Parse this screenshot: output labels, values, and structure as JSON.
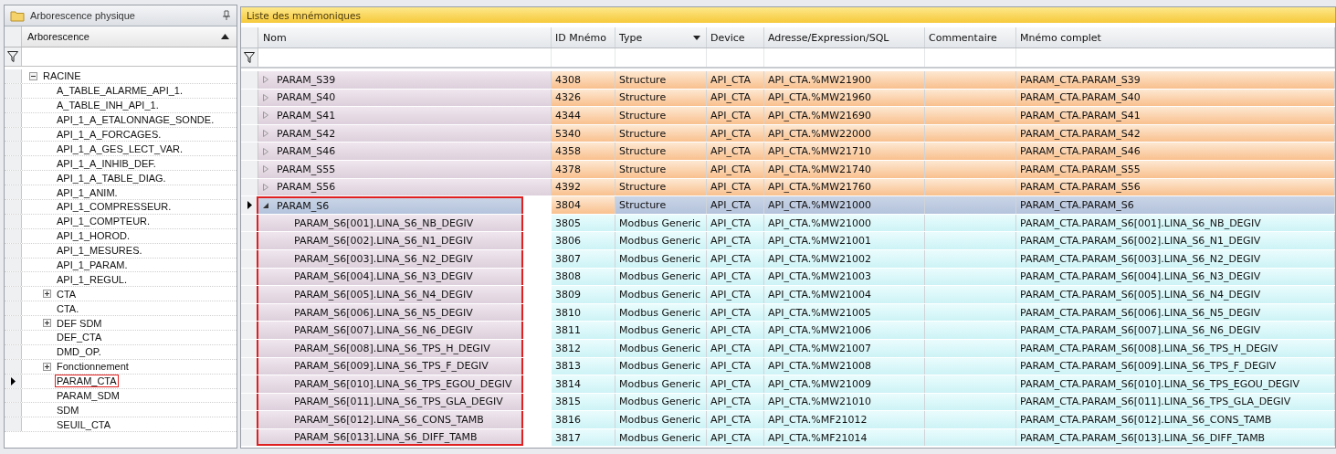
{
  "tree_panel": {
    "title": "Arborescence physique",
    "column": "Arborescence",
    "items": [
      {
        "label": "RACINE",
        "kind": "group",
        "expanded": true,
        "selected": false,
        "highlighted": false,
        "children": [
          {
            "label": "A_TABLE_ALARME_API_1.",
            "kind": "leaf",
            "selected": false,
            "highlighted": false
          },
          {
            "label": "A_TABLE_INH_API_1.",
            "kind": "leaf",
            "selected": false,
            "highlighted": false
          },
          {
            "label": "API_1_A_ETALONNAGE_SONDE.",
            "kind": "leaf",
            "selected": false,
            "highlighted": false
          },
          {
            "label": "API_1_A_FORCAGES.",
            "kind": "leaf",
            "selected": false,
            "highlighted": false
          },
          {
            "label": "API_1_A_GES_LECT_VAR.",
            "kind": "leaf",
            "selected": false,
            "highlighted": false
          },
          {
            "label": "API_1_A_INHIB_DEF.",
            "kind": "leaf",
            "selected": false,
            "highlighted": false
          },
          {
            "label": "API_1_A_TABLE_DIAG.",
            "kind": "leaf",
            "selected": false,
            "highlighted": false
          },
          {
            "label": "API_1_ANIM.",
            "kind": "leaf",
            "selected": false,
            "highlighted": false
          },
          {
            "label": "API_1_COMPRESSEUR.",
            "kind": "leaf",
            "selected": false,
            "highlighted": false
          },
          {
            "label": "API_1_COMPTEUR.",
            "kind": "leaf",
            "selected": false,
            "highlighted": false
          },
          {
            "label": "API_1_HOROD.",
            "kind": "leaf",
            "selected": false,
            "highlighted": false
          },
          {
            "label": "API_1_MESURES.",
            "kind": "leaf",
            "selected": false,
            "highlighted": false
          },
          {
            "label": "API_1_PARAM.",
            "kind": "leaf",
            "selected": false,
            "highlighted": false
          },
          {
            "label": "API_1_REGUL.",
            "kind": "leaf",
            "selected": false,
            "highlighted": false
          },
          {
            "label": "CTA",
            "kind": "group",
            "expanded": false,
            "selected": false,
            "highlighted": false
          },
          {
            "label": "CTA.",
            "kind": "leaf",
            "selected": false,
            "highlighted": false
          },
          {
            "label": "DEF SDM",
            "kind": "group",
            "expanded": false,
            "selected": false,
            "highlighted": false
          },
          {
            "label": "DEF_CTA",
            "kind": "leaf",
            "selected": false,
            "highlighted": false
          },
          {
            "label": "DMD_OP.",
            "kind": "leaf",
            "selected": false,
            "highlighted": false
          },
          {
            "label": "Fonctionnement",
            "kind": "group",
            "expanded": false,
            "selected": false,
            "highlighted": false
          },
          {
            "label": "PARAM_CTA",
            "kind": "leaf",
            "selected": true,
            "highlighted": true
          },
          {
            "label": "PARAM_SDM",
            "kind": "leaf",
            "selected": false,
            "highlighted": false
          },
          {
            "label": "SDM",
            "kind": "leaf",
            "selected": false,
            "highlighted": false
          },
          {
            "label": "SEUIL_CTA",
            "kind": "leaf",
            "selected": false,
            "highlighted": false
          }
        ]
      }
    ]
  },
  "table": {
    "title": "Liste des mnémoniques",
    "columns": [
      "Nom",
      "ID Mnémo",
      "Type",
      "Device",
      "Adresse/Expression/SQL",
      "Commentaire",
      "Mnémo complet"
    ],
    "rows": [
      {
        "kind": "structure",
        "expanded": false,
        "selected": false,
        "highlighted": false,
        "nom": "PARAM_S39",
        "id": "4308",
        "type": "Structure",
        "device": "API_CTA",
        "address": "API_CTA.%MW21900",
        "full": "PARAM_CTA.PARAM_S39"
      },
      {
        "kind": "structure",
        "expanded": false,
        "selected": false,
        "highlighted": false,
        "nom": "PARAM_S40",
        "id": "4326",
        "type": "Structure",
        "device": "API_CTA",
        "address": "API_CTA.%MW21960",
        "full": "PARAM_CTA.PARAM_S40"
      },
      {
        "kind": "structure",
        "expanded": false,
        "selected": false,
        "highlighted": false,
        "nom": "PARAM_S41",
        "id": "4344",
        "type": "Structure",
        "device": "API_CTA",
        "address": "API_CTA.%MW21690",
        "full": "PARAM_CTA.PARAM_S41"
      },
      {
        "kind": "structure",
        "expanded": false,
        "selected": false,
        "highlighted": false,
        "nom": "PARAM_S42",
        "id": "5340",
        "type": "Structure",
        "device": "API_CTA",
        "address": "API_CTA.%MW22000",
        "full": "PARAM_CTA.PARAM_S42"
      },
      {
        "kind": "structure",
        "expanded": false,
        "selected": false,
        "highlighted": false,
        "nom": "PARAM_S46",
        "id": "4358",
        "type": "Structure",
        "device": "API_CTA",
        "address": "API_CTA.%MW21710",
        "full": "PARAM_CTA.PARAM_S46"
      },
      {
        "kind": "structure",
        "expanded": false,
        "selected": false,
        "highlighted": false,
        "nom": "PARAM_S55",
        "id": "4378",
        "type": "Structure",
        "device": "API_CTA",
        "address": "API_CTA.%MW21740",
        "full": "PARAM_CTA.PARAM_S55"
      },
      {
        "kind": "structure",
        "expanded": false,
        "selected": false,
        "highlighted": false,
        "nom": "PARAM_S56",
        "id": "4392",
        "type": "Structure",
        "device": "API_CTA",
        "address": "API_CTA.%MW21760",
        "full": "PARAM_CTA.PARAM_S56"
      },
      {
        "kind": "structure",
        "expanded": true,
        "selected": true,
        "highlighted": true,
        "nom": "PARAM_S6",
        "id": "3804",
        "type": "Structure",
        "device": "API_CTA",
        "address": "API_CTA.%MW21000",
        "full": "PARAM_CTA.PARAM_S6"
      },
      {
        "kind": "member",
        "selected": false,
        "highlighted": true,
        "nom": "PARAM_S6[001].LINA_S6_NB_DEGIV",
        "id": "3805",
        "type": "Modbus Generic",
        "device": "API_CTA",
        "address": "API_CTA.%MW21000",
        "full": "PARAM_CTA.PARAM_S6[001].LINA_S6_NB_DEGIV"
      },
      {
        "kind": "member",
        "selected": false,
        "highlighted": true,
        "nom": "PARAM_S6[002].LINA_S6_N1_DEGIV",
        "id": "3806",
        "type": "Modbus Generic",
        "device": "API_CTA",
        "address": "API_CTA.%MW21001",
        "full": "PARAM_CTA.PARAM_S6[002].LINA_S6_N1_DEGIV"
      },
      {
        "kind": "member",
        "selected": false,
        "highlighted": true,
        "nom": "PARAM_S6[003].LINA_S6_N2_DEGIV",
        "id": "3807",
        "type": "Modbus Generic",
        "device": "API_CTA",
        "address": "API_CTA.%MW21002",
        "full": "PARAM_CTA.PARAM_S6[003].LINA_S6_N2_DEGIV"
      },
      {
        "kind": "member",
        "selected": false,
        "highlighted": true,
        "nom": "PARAM_S6[004].LINA_S6_N3_DEGIV",
        "id": "3808",
        "type": "Modbus Generic",
        "device": "API_CTA",
        "address": "API_CTA.%MW21003",
        "full": "PARAM_CTA.PARAM_S6[004].LINA_S6_N3_DEGIV"
      },
      {
        "kind": "member",
        "selected": false,
        "highlighted": true,
        "nom": "PARAM_S6[005].LINA_S6_N4_DEGIV",
        "id": "3809",
        "type": "Modbus Generic",
        "device": "API_CTA",
        "address": "API_CTA.%MW21004",
        "full": "PARAM_CTA.PARAM_S6[005].LINA_S6_N4_DEGIV"
      },
      {
        "kind": "member",
        "selected": false,
        "highlighted": true,
        "nom": "PARAM_S6[006].LINA_S6_N5_DEGIV",
        "id": "3810",
        "type": "Modbus Generic",
        "device": "API_CTA",
        "address": "API_CTA.%MW21005",
        "full": "PARAM_CTA.PARAM_S6[006].LINA_S6_N5_DEGIV"
      },
      {
        "kind": "member",
        "selected": false,
        "highlighted": true,
        "nom": "PARAM_S6[007].LINA_S6_N6_DEGIV",
        "id": "3811",
        "type": "Modbus Generic",
        "device": "API_CTA",
        "address": "API_CTA.%MW21006",
        "full": "PARAM_CTA.PARAM_S6[007].LINA_S6_N6_DEGIV"
      },
      {
        "kind": "member",
        "selected": false,
        "highlighted": true,
        "nom": "PARAM_S6[008].LINA_S6_TPS_H_DEGIV",
        "id": "3812",
        "type": "Modbus Generic",
        "device": "API_CTA",
        "address": "API_CTA.%MW21007",
        "full": "PARAM_CTA.PARAM_S6[008].LINA_S6_TPS_H_DEGIV"
      },
      {
        "kind": "member",
        "selected": false,
        "highlighted": true,
        "nom": "PARAM_S6[009].LINA_S6_TPS_F_DEGIV",
        "id": "3813",
        "type": "Modbus Generic",
        "device": "API_CTA",
        "address": "API_CTA.%MW21008",
        "full": "PARAM_CTA.PARAM_S6[009].LINA_S6_TPS_F_DEGIV"
      },
      {
        "kind": "member",
        "selected": false,
        "highlighted": true,
        "nom": "PARAM_S6[010].LINA_S6_TPS_EGOU_DEGIV",
        "id": "3814",
        "type": "Modbus Generic",
        "device": "API_CTA",
        "address": "API_CTA.%MW21009",
        "full": "PARAM_CTA.PARAM_S6[010].LINA_S6_TPS_EGOU_DEGIV"
      },
      {
        "kind": "member",
        "selected": false,
        "highlighted": true,
        "nom": "PARAM_S6[011].LINA_S6_TPS_GLA_DEGIV",
        "id": "3815",
        "type": "Modbus Generic",
        "device": "API_CTA",
        "address": "API_CTA.%MW21010",
        "full": "PARAM_CTA.PARAM_S6[011].LINA_S6_TPS_GLA_DEGIV"
      },
      {
        "kind": "member",
        "selected": false,
        "highlighted": true,
        "nom": "PARAM_S6[012].LINA_S6_CONS_TAMB",
        "id": "3816",
        "type": "Modbus Generic",
        "device": "API_CTA",
        "address": "API_CTA.%MF21012",
        "full": "PARAM_CTA.PARAM_S6[012].LINA_S6_CONS_TAMB"
      },
      {
        "kind": "member",
        "selected": false,
        "highlighted": true,
        "nom": "PARAM_S6[013].LINA_S6_DIFF_TAMB",
        "id": "3817",
        "type": "Modbus Generic",
        "device": "API_CTA",
        "address": "API_CTA.%MF21014",
        "full": "PARAM_CTA.PARAM_S6[013].LINA_S6_DIFF_TAMB"
      }
    ]
  }
}
